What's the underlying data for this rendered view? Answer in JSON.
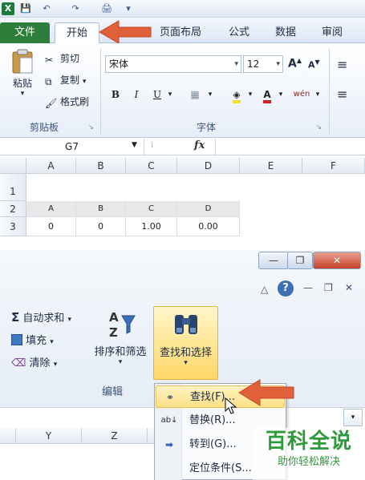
{
  "qat": {
    "logo": "X",
    "save": "💾",
    "undo": "↶",
    "redo": "↷",
    "print": "🖨",
    "more": "▾"
  },
  "tabs": {
    "file": "文件",
    "home": "开始",
    "layout": "页面布局",
    "formulas": "公式",
    "data": "数据",
    "review": "审阅"
  },
  "clipboard": {
    "paste": "粘贴",
    "cut": "剪切",
    "copy": "复制",
    "copy_dd": "▾",
    "format_painter": "格式刷",
    "group": "剪贴板",
    "launcher": "↘"
  },
  "font": {
    "name": "宋体",
    "size": "12",
    "grow": "A",
    "shrink": "A",
    "bold": "B",
    "italic": "I",
    "underline": "U",
    "border": "▦",
    "fill": "A",
    "color": "A",
    "phonetic": "wén",
    "group": "字体",
    "launcher": "↘"
  },
  "align": {
    "icon1": "≡",
    "icon2": "≡"
  },
  "formula_bar": {
    "name_box": "G7",
    "fx": "fx"
  },
  "sheet1": {
    "columns": [
      "A",
      "B",
      "C",
      "D",
      "E",
      "F"
    ],
    "rows": [
      "1",
      "2",
      "3"
    ],
    "row2": [
      "A",
      "B",
      "C",
      "D"
    ],
    "row3": [
      "0",
      "0",
      "1.00",
      "0.00"
    ]
  },
  "window": {
    "min": "—",
    "restore": "❐",
    "close": "✕",
    "caret": "△",
    "help": "?",
    "min2": "—",
    "restore2": "❐",
    "close2": "✕"
  },
  "editing": {
    "autosum": "自动求和",
    "fill": "填充",
    "clear": "清除",
    "dd": "▾",
    "sort_filter": "排序和筛选",
    "find_select": "查找和选择",
    "group": "编辑"
  },
  "menu": {
    "find": "查找(F)...",
    "replace": "替换(R)...",
    "goto": "转到(G)...",
    "goto_special": "定位条件(S..."
  },
  "sheet2": {
    "columns": [
      "Y",
      "Z"
    ]
  },
  "watermark": {
    "title": "百科全说",
    "subtitle": "助你轻松解决"
  },
  "colors": {
    "accent_arrow": "#e0603a",
    "file_tab": "#2f7d3a",
    "find_highlight": "#ffd768"
  }
}
